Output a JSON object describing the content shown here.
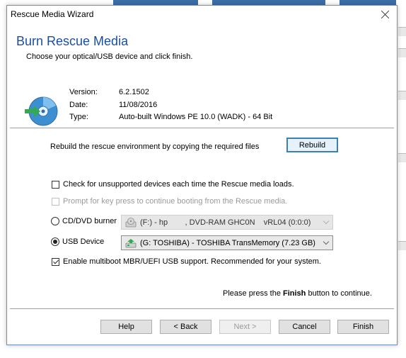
{
  "window": {
    "title": "Rescue Media Wizard"
  },
  "header": {
    "title": "Burn Rescue Media",
    "subtitle": "Choose your optical/USB device and click finish."
  },
  "info": {
    "version_label": "Version:",
    "version_value": "6.2.1502",
    "date_label": "Date:",
    "date_value": "11/08/2016",
    "type_label": "Type:",
    "type_value": "Auto-built Windows PE 10.0 (WADK) - 64 Bit"
  },
  "rebuild": {
    "text": "Rebuild the rescue environment by copying the required files",
    "button_label": "Rebuild"
  },
  "options": {
    "check_unsupported_label": "Check for unsupported devices each time the Rescue media loads.",
    "check_unsupported_checked": false,
    "prompt_key_label": "Prompt for key press to continue booting from the Rescue media.",
    "prompt_key_checked": false,
    "multiboot_label": "Enable multiboot MBR/UEFI USB support. Recommended for your system.",
    "multiboot_checked": true
  },
  "devices": {
    "cd_label": "CD/DVD burner",
    "cd_selected_value": "(F:) - hp        , DVD-RAM GHC0N    vRL04 (0:0:0)",
    "usb_label": "USB Device",
    "usb_selected_value": "(G: TOSHIBA) - TOSHIBA TransMemory (7.23 GB)",
    "selected": "usb"
  },
  "finish_note": {
    "prefix": "Please press the ",
    "bold": "Finish",
    "suffix": " button to continue."
  },
  "footer": {
    "help": "Help",
    "back": "< Back",
    "next": "Next >",
    "cancel": "Cancel",
    "finish": "Finish"
  },
  "colors": {
    "heading": "#1d4e9e",
    "accent_border": "#3c7fb1",
    "window_border": "#6d8fbd"
  },
  "icons": {
    "app_icon": "disc-with-arrow-icon",
    "cd_drive_icon": "optical-drive-icon",
    "usb_drive_icon": "usb-drive-icon"
  }
}
